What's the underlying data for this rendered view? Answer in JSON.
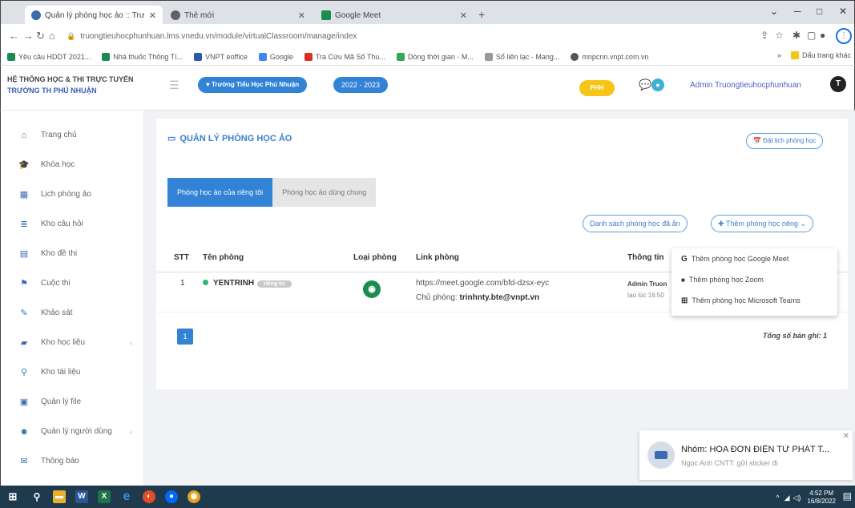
{
  "browser": {
    "tabs": [
      {
        "label": "Quản lý phòng học ảo :: Trường",
        "close": "✕",
        "active": true
      },
      {
        "label": "Thẻ mới",
        "close": "✕",
        "active": false
      },
      {
        "label": "Google Meet",
        "close": "✕",
        "active": false
      }
    ],
    "new_tab": "+",
    "url": "truongtieuhocphunhuan.lms.vnedu.vn/module/virtualClassroom/manage/index",
    "bookmarks": [
      "Yêu cầu HDDT 2021...",
      "Nhà thuốc Thông Tí...",
      "VNPT eoffice",
      "Google",
      "Tra Cứu Mã Số Thu...",
      "Dòng thời gian - M...",
      "Sổ liên lạc - Mang...",
      "mnpcnn.vnpt.com.vn"
    ],
    "bookmarks_more": "»",
    "bookmarks_folder": "Dấu trang khác",
    "profile_letter": "⋮"
  },
  "header": {
    "system_title": "HỆ THỐNG HỌC & THI TRỰC TUYẾN",
    "school_name": "TRƯỜNG TH PHÚ NHUẬN",
    "school_pill": "♥ Trường Tiểu Học Phú Nhuận",
    "year_pill": "2022 - 2023",
    "phu_pill": "PHH",
    "user": "Admin Truongtieuhocphunhuan",
    "avatar_letter": "T"
  },
  "sidebar": {
    "items": [
      {
        "label": "Trang chủ",
        "icon": "home-icon",
        "glyph": "⌂",
        "color": "#3a6cb2",
        "chevron": ""
      },
      {
        "label": "Khóa học",
        "icon": "graduation-cap-icon",
        "glyph": "🎓",
        "color": "#3a6cb2",
        "chevron": ""
      },
      {
        "label": "Lịch phòng ảo",
        "icon": "calendar-icon",
        "glyph": "▦",
        "color": "#3a6cb2",
        "chevron": ""
      },
      {
        "label": "Kho câu hỏi",
        "icon": "database-icon",
        "glyph": "≣",
        "color": "#3a6cb2",
        "chevron": ""
      },
      {
        "label": "Kho đề thi",
        "icon": "file-icon",
        "glyph": "▤",
        "color": "#3a6cb2",
        "chevron": ""
      },
      {
        "label": "Cuộc thi",
        "icon": "contest-icon",
        "glyph": "⚑",
        "color": "#3a6cb2",
        "chevron": ""
      },
      {
        "label": "Khảo sát",
        "icon": "survey-icon",
        "glyph": "✎",
        "color": "#3a6cb2",
        "chevron": ""
      },
      {
        "label": "Kho học liệu",
        "icon": "library-icon",
        "glyph": "▰",
        "color": "#3a6cb2",
        "chevron": "‹"
      },
      {
        "label": "Kho tài liệu",
        "icon": "paperclip-icon",
        "glyph": "⚲",
        "color": "#3a6cb2",
        "chevron": ""
      },
      {
        "label": "Quản lý file",
        "icon": "file-manager-icon",
        "glyph": "▣",
        "color": "#3a6cb2",
        "chevron": ""
      },
      {
        "label": "Quản lý người dùng",
        "icon": "users-icon",
        "glyph": "☻",
        "color": "#3a6cb2",
        "chevron": "‹"
      },
      {
        "label": "Thông báo",
        "icon": "notification-icon",
        "glyph": "✉",
        "color": "#3a6cb2",
        "chevron": ""
      }
    ]
  },
  "main": {
    "title": "QUẢN LÝ PHÒNG HỌC ẢO",
    "schedule_button": "📅 Đặt lịch phòng học",
    "tabs": [
      "Phòng học ảo của riêng tôi",
      "Phòng học ảo dùng chung"
    ],
    "hidden_list_button": "Danh sách phòng học đã ẩn",
    "add_private_button": "✚ Thêm phòng học riêng ⌄",
    "columns": [
      "STT",
      "Tên phòng",
      "Loại phòng",
      "Link phòng",
      "Thông tin"
    ],
    "rows": [
      {
        "stt": "1",
        "name": "YENTRINH",
        "badge": "riêng tư",
        "link": "https://meet.google.com/bfd-dzsx-eyc",
        "owner_label": "Chủ phòng:",
        "owner": "trinhnty.bte@vnpt.vn",
        "info_line1": "Admin Truon",
        "info_line2": "tạo lúc 16:50"
      }
    ],
    "page": "1",
    "total": "Tổng số bản ghi: 1",
    "dropdown": [
      {
        "icon": "G",
        "label": "Thêm phòng học Google Meet"
      },
      {
        "icon": "■",
        "label": "Thêm phòng học Zoom"
      },
      {
        "icon": "⊞",
        "label": "Thêm phòng học Microsoft Teams"
      }
    ]
  },
  "toast": {
    "title": "Nhóm: HÓA ĐƠN ĐIỆN TỬ PHÁT T...",
    "subtitle": "Ngọc Anh CNTT: gửi sticker đi",
    "close": "✕"
  },
  "taskbar": {
    "time": "4:52 PM",
    "date": "16/8/2022"
  }
}
